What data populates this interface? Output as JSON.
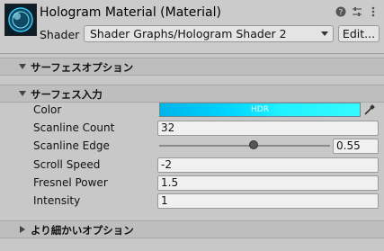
{
  "header": {
    "title": "Hologram Material (Material)",
    "icons": [
      "help-icon",
      "settings-sliders-icon",
      "more-icon"
    ],
    "shader_label": "Shader",
    "shader_value": "Shader Graphs/Hologram Shader 2",
    "edit_label": "Edit..."
  },
  "sections": {
    "surface_options": "サーフェスオプション",
    "surface_inputs": "サーフェス入力",
    "advanced_options": "より細かいオプション"
  },
  "properties": {
    "color": {
      "label": "Color",
      "badge": "HDR",
      "value_color": "#1ff1ff"
    },
    "scanline_count": {
      "label": "Scanline Count",
      "value": "32"
    },
    "scanline_edge": {
      "label": "Scanline Edge",
      "value": "0.55",
      "slider_fraction": 0.55
    },
    "scroll_speed": {
      "label": "Scroll Speed",
      "value": "-2"
    },
    "fresnel_power": {
      "label": "Fresnel Power",
      "value": "1.5"
    },
    "intensity": {
      "label": "Intensity",
      "value": "1"
    }
  }
}
